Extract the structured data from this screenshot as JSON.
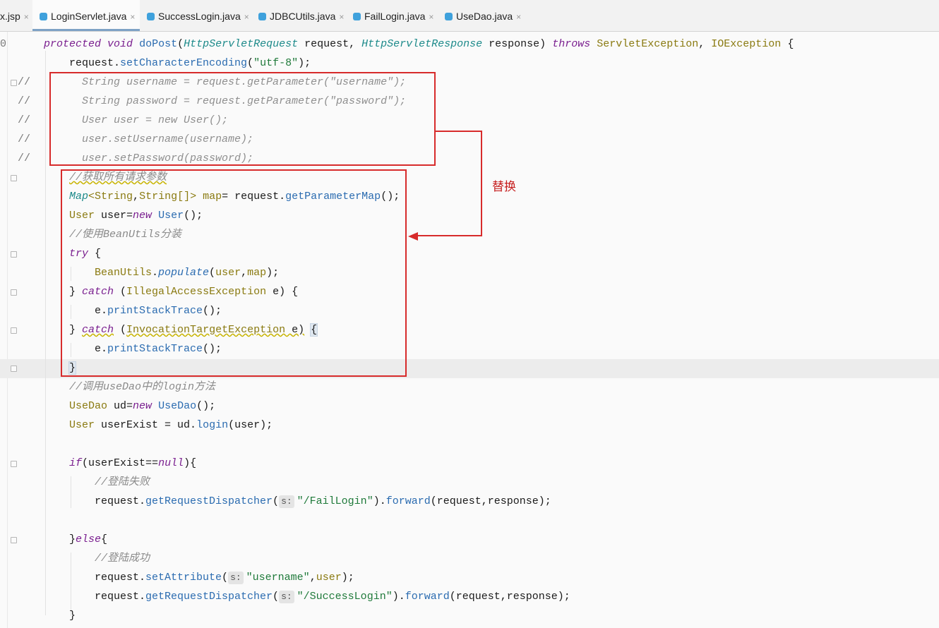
{
  "tabs": [
    {
      "label": "x.jsp"
    },
    {
      "label": "LoginServlet.java",
      "active": true
    },
    {
      "label": "SuccessLogin.java"
    },
    {
      "label": "JDBCUtils.java"
    },
    {
      "label": "FailLogin.java"
    },
    {
      "label": "UseDao.java"
    }
  ],
  "tab_close_glyph": "×",
  "gutter_zero": "0",
  "comment_marker": "//",
  "annotation": {
    "label": "替换",
    "color": "#d72b2b"
  },
  "code": {
    "signature": {
      "kw1": "protected",
      "kw2": "void",
      "name": "doPost",
      "t1": "HttpServletRequest",
      "p1": " request, ",
      "t2": "HttpServletResponse",
      "p2": " response) ",
      "throws": "throws",
      "e1": "ServletException",
      "e2": "IOException",
      "open": " {"
    },
    "l2": {
      "obj": "request.",
      "fn": "setCharacterEncoding",
      "str": "\"utf-8\"",
      "end": ");"
    },
    "commented": [
      "String username = request.getParameter(\"username\");",
      "String password = request.getParameter(\"password\");",
      "User user = new User();",
      "user.setUsername(username);",
      "user.setPassword(password);"
    ],
    "c_params": "//获取所有请求参数",
    "map_line": {
      "t1": "Map",
      "t2": "String",
      "t3": "String",
      "var": "map",
      "obj": " request.",
      "fn": "getParameterMap",
      "end": "();"
    },
    "user_line": {
      "t": "User",
      "var": " user=",
      "kw": "new",
      "fn": "User",
      "end": "();"
    },
    "c_beanutils": "//使用BeanUtils分装",
    "try_kw": "try",
    "populate": {
      "cls": "BeanUtils",
      "fn": "populate",
      "args1": "user",
      "args2": "map"
    },
    "catch_kw": "catch",
    "ex1": "IllegalAccessException",
    "ex2": "InvocationTargetException",
    "print": {
      "obj": "e.",
      "fn": "printStackTrace",
      "end": "();"
    },
    "c_dao": "//调用useDao中的login方法",
    "dao_line": {
      "t": "UseDao",
      "var": " ud=",
      "kw": "new",
      "fn": "UseDao",
      "end": "();"
    },
    "exist_line": {
      "t": "User",
      "var": " userExist",
      "op": " = ",
      "obj": "ud.",
      "fn": "login",
      "arg": "user",
      "end": ");"
    },
    "if_kw": "if",
    "null_kw": "null",
    "else_kw": "else",
    "if_cond": "userExist==",
    "c_fail": "//登陆失败",
    "c_success": "//登陆成功",
    "hint_s": "s:",
    "fail_path": "\"/FailLogin\"",
    "success_path": "\"/SuccessLogin\"",
    "username_str": "\"username\"",
    "dispatcher": {
      "obj": "request.",
      "fn": "getRequestDispatcher",
      "fwd": "forward",
      "args": "(request,response);"
    },
    "set_attr": {
      "obj": "request.",
      "fn": "setAttribute",
      "arg2": "user",
      "end": ");"
    }
  }
}
